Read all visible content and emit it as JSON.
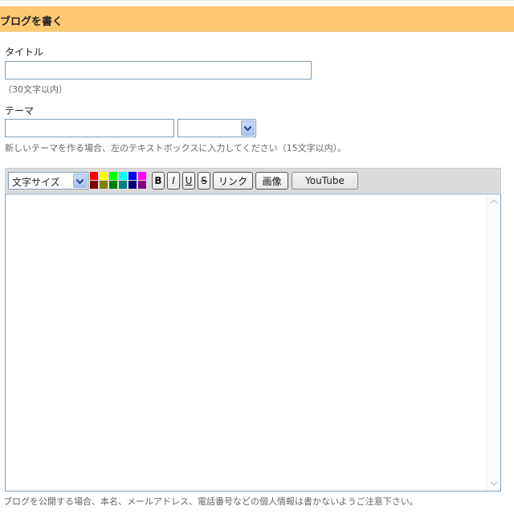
{
  "header": {
    "title": "ブログを書く"
  },
  "title_field": {
    "label": "タイトル",
    "value": "",
    "hint": "（30文字以内）"
  },
  "theme_field": {
    "label": "テーマ",
    "value": "",
    "select_value": "",
    "hint": "新しいテーマを作る場合、左のテキストボックスに入力してください（15文字以内）。"
  },
  "toolbar": {
    "font_size_label": "文字サイズ",
    "colors": [
      "#ff0000",
      "#ffff00",
      "#00ff00",
      "#00ffff",
      "#0000ff",
      "#ff00ff",
      "#800000",
      "#808000",
      "#008000",
      "#008080",
      "#000080",
      "#800080"
    ],
    "bold_label": "B",
    "italic_label": "I",
    "underline_label": "U",
    "strike_label": "S",
    "link_label": "リンク",
    "image_label": "画像",
    "youtube_label": "YouTube"
  },
  "editor": {
    "value": ""
  },
  "footer_note": "ブログを公開する場合、本名、メールアドレス、電話番号などの個人情報は書かないようご注意下さい。",
  "accent_colors": {
    "header_bg": "#fdc972",
    "toolbar_bg": "#dcdcdc",
    "input_border": "#7f9db9"
  }
}
